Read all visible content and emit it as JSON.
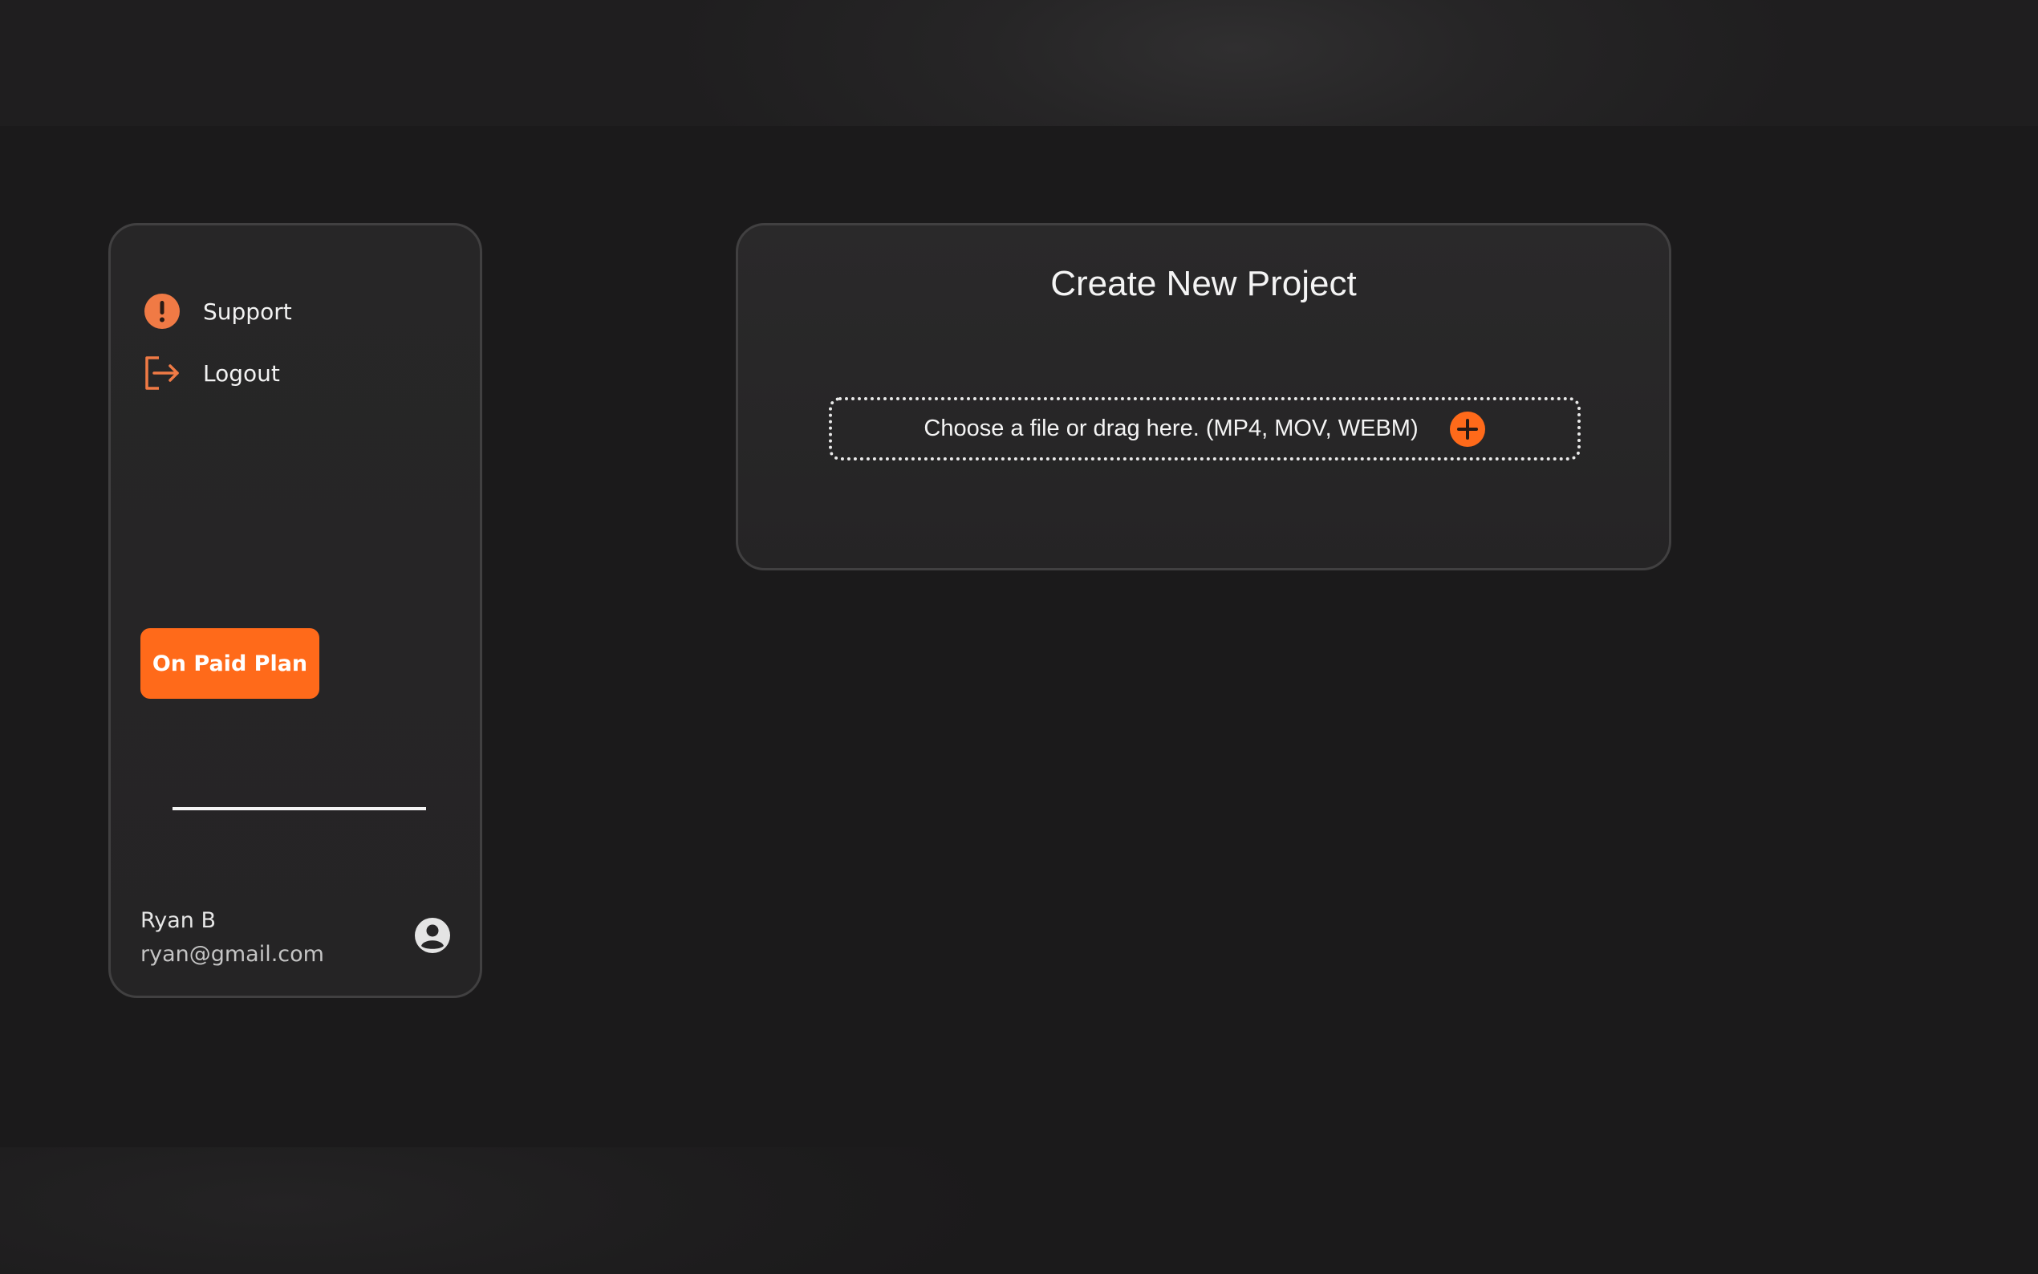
{
  "sidebar": {
    "items": [
      {
        "label": "Support",
        "icon": "alert-circle-icon"
      },
      {
        "label": "Logout",
        "icon": "logout-icon"
      }
    ],
    "plan_button_label": "On Paid Plan",
    "user": {
      "name": "Ryan B",
      "email": "ryan@gmail.com",
      "avatar_icon": "user-circle-icon"
    }
  },
  "main": {
    "card_title": "Create New Project",
    "dropzone": {
      "text": "Choose a file or drag here. (MP4, MOV, WEBM)",
      "icon": "plus-circle-icon"
    }
  },
  "colors": {
    "accent": "#ff6a1a",
    "icon_accent": "#f07a45",
    "background": "#1b1a1b",
    "panel": "#272627",
    "border": "#414041"
  }
}
